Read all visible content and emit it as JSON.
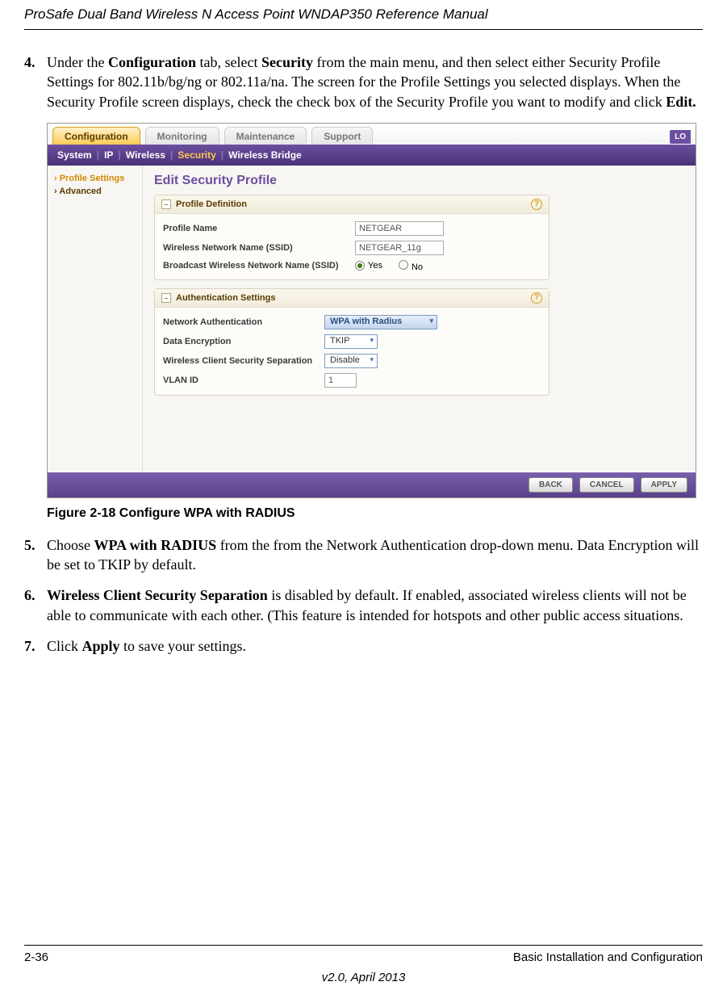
{
  "header": {
    "title": "ProSafe Dual Band Wireless N Access Point WNDAP350 Reference Manual"
  },
  "steps": {
    "s4": {
      "num": "4.",
      "p1a": "Under the ",
      "p1b": "Configuration",
      "p1c": " tab, select ",
      "p1d": "Security",
      "p1e": " from the main menu, and then select either Security Profile Settings for 802.11b/bg/ng or 802.11a/na. The screen for the Profile Settings you selected displays. When the Security Profile screen displays, check the check box of the Security Profile you want to modify and click ",
      "p1f": "Edit."
    },
    "s5": {
      "num": "5.",
      "p1a": "Choose ",
      "p1b": "WPA with RADIUS",
      "p1c": " from the from the Network Authentication drop-down menu. Data Encryption will be set to TKIP by default."
    },
    "s6": {
      "num": "6.",
      "p1a": "Wireless Client Security Separation",
      "p1b": " is disabled by default. If enabled, associated wireless clients will not be able to communicate with each other. (This feature is intended for hotspots and other public access situations."
    },
    "s7": {
      "num": "7.",
      "p1a": "Click ",
      "p1b": "Apply",
      "p1c": " to save your settings."
    }
  },
  "figure": {
    "caption": "Figure 2-18  Configure WPA with RADIUS"
  },
  "ui": {
    "tabs": {
      "configuration": "Configuration",
      "monitoring": "Monitoring",
      "maintenance": "Maintenance",
      "support": "Support",
      "logout": "LO"
    },
    "subnav": {
      "system": "System",
      "ip": "IP",
      "wireless": "Wireless",
      "security": "Security",
      "bridge": "Wireless Bridge",
      "sep": "|"
    },
    "sidebar": {
      "profile": "› Profile Settings",
      "advanced": "› Advanced"
    },
    "panel": {
      "title": "Edit Security Profile",
      "box1": {
        "head": "Profile Definition",
        "profile_name_label": "Profile Name",
        "profile_name_value": "NETGEAR",
        "ssid_label": "Wireless Network Name (SSID)",
        "ssid_value": "NETGEAR_11g",
        "broadcast_label": "Broadcast Wireless Network Name (SSID)",
        "yes": "Yes",
        "no": "No"
      },
      "box2": {
        "head": "Authentication Settings",
        "netauth_label": "Network Authentication",
        "netauth_value": "WPA with Radius",
        "dataenc_label": "Data Encryption",
        "dataenc_value": "TKIP",
        "sep_label": "Wireless Client Security Separation",
        "sep_value": "Disable",
        "vlan_label": "VLAN ID",
        "vlan_value": "1"
      }
    },
    "buttons": {
      "back": "BACK",
      "cancel": "CANCEL",
      "apply": "APPLY"
    },
    "help": "?"
  },
  "footer": {
    "page": "2-36",
    "section": "Basic Installation and Configuration",
    "version": "v2.0, April 2013"
  }
}
